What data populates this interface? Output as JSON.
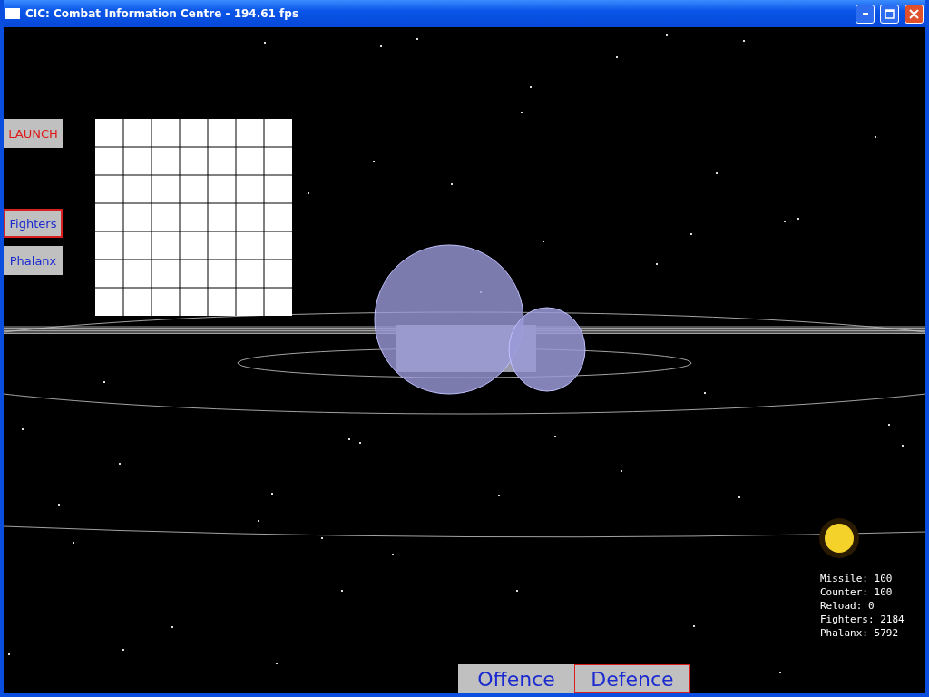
{
  "window": {
    "title": "CIC: Combat Information Centre - 194.61 fps"
  },
  "side_buttons": [
    {
      "label": "LAUNCH",
      "kind": "action",
      "selected": false
    },
    {
      "label": "Fighters",
      "kind": "mode",
      "selected": true
    },
    {
      "label": "Phalanx",
      "kind": "mode",
      "selected": false
    }
  ],
  "stats": [
    "Missile: 100",
    "Counter: 100",
    "Reload: 0",
    "Fighters: 2184",
    "Phalanx: 5792"
  ],
  "tabs": [
    {
      "label": "Offence",
      "selected": false
    },
    {
      "label": "Defence",
      "selected": true
    }
  ]
}
